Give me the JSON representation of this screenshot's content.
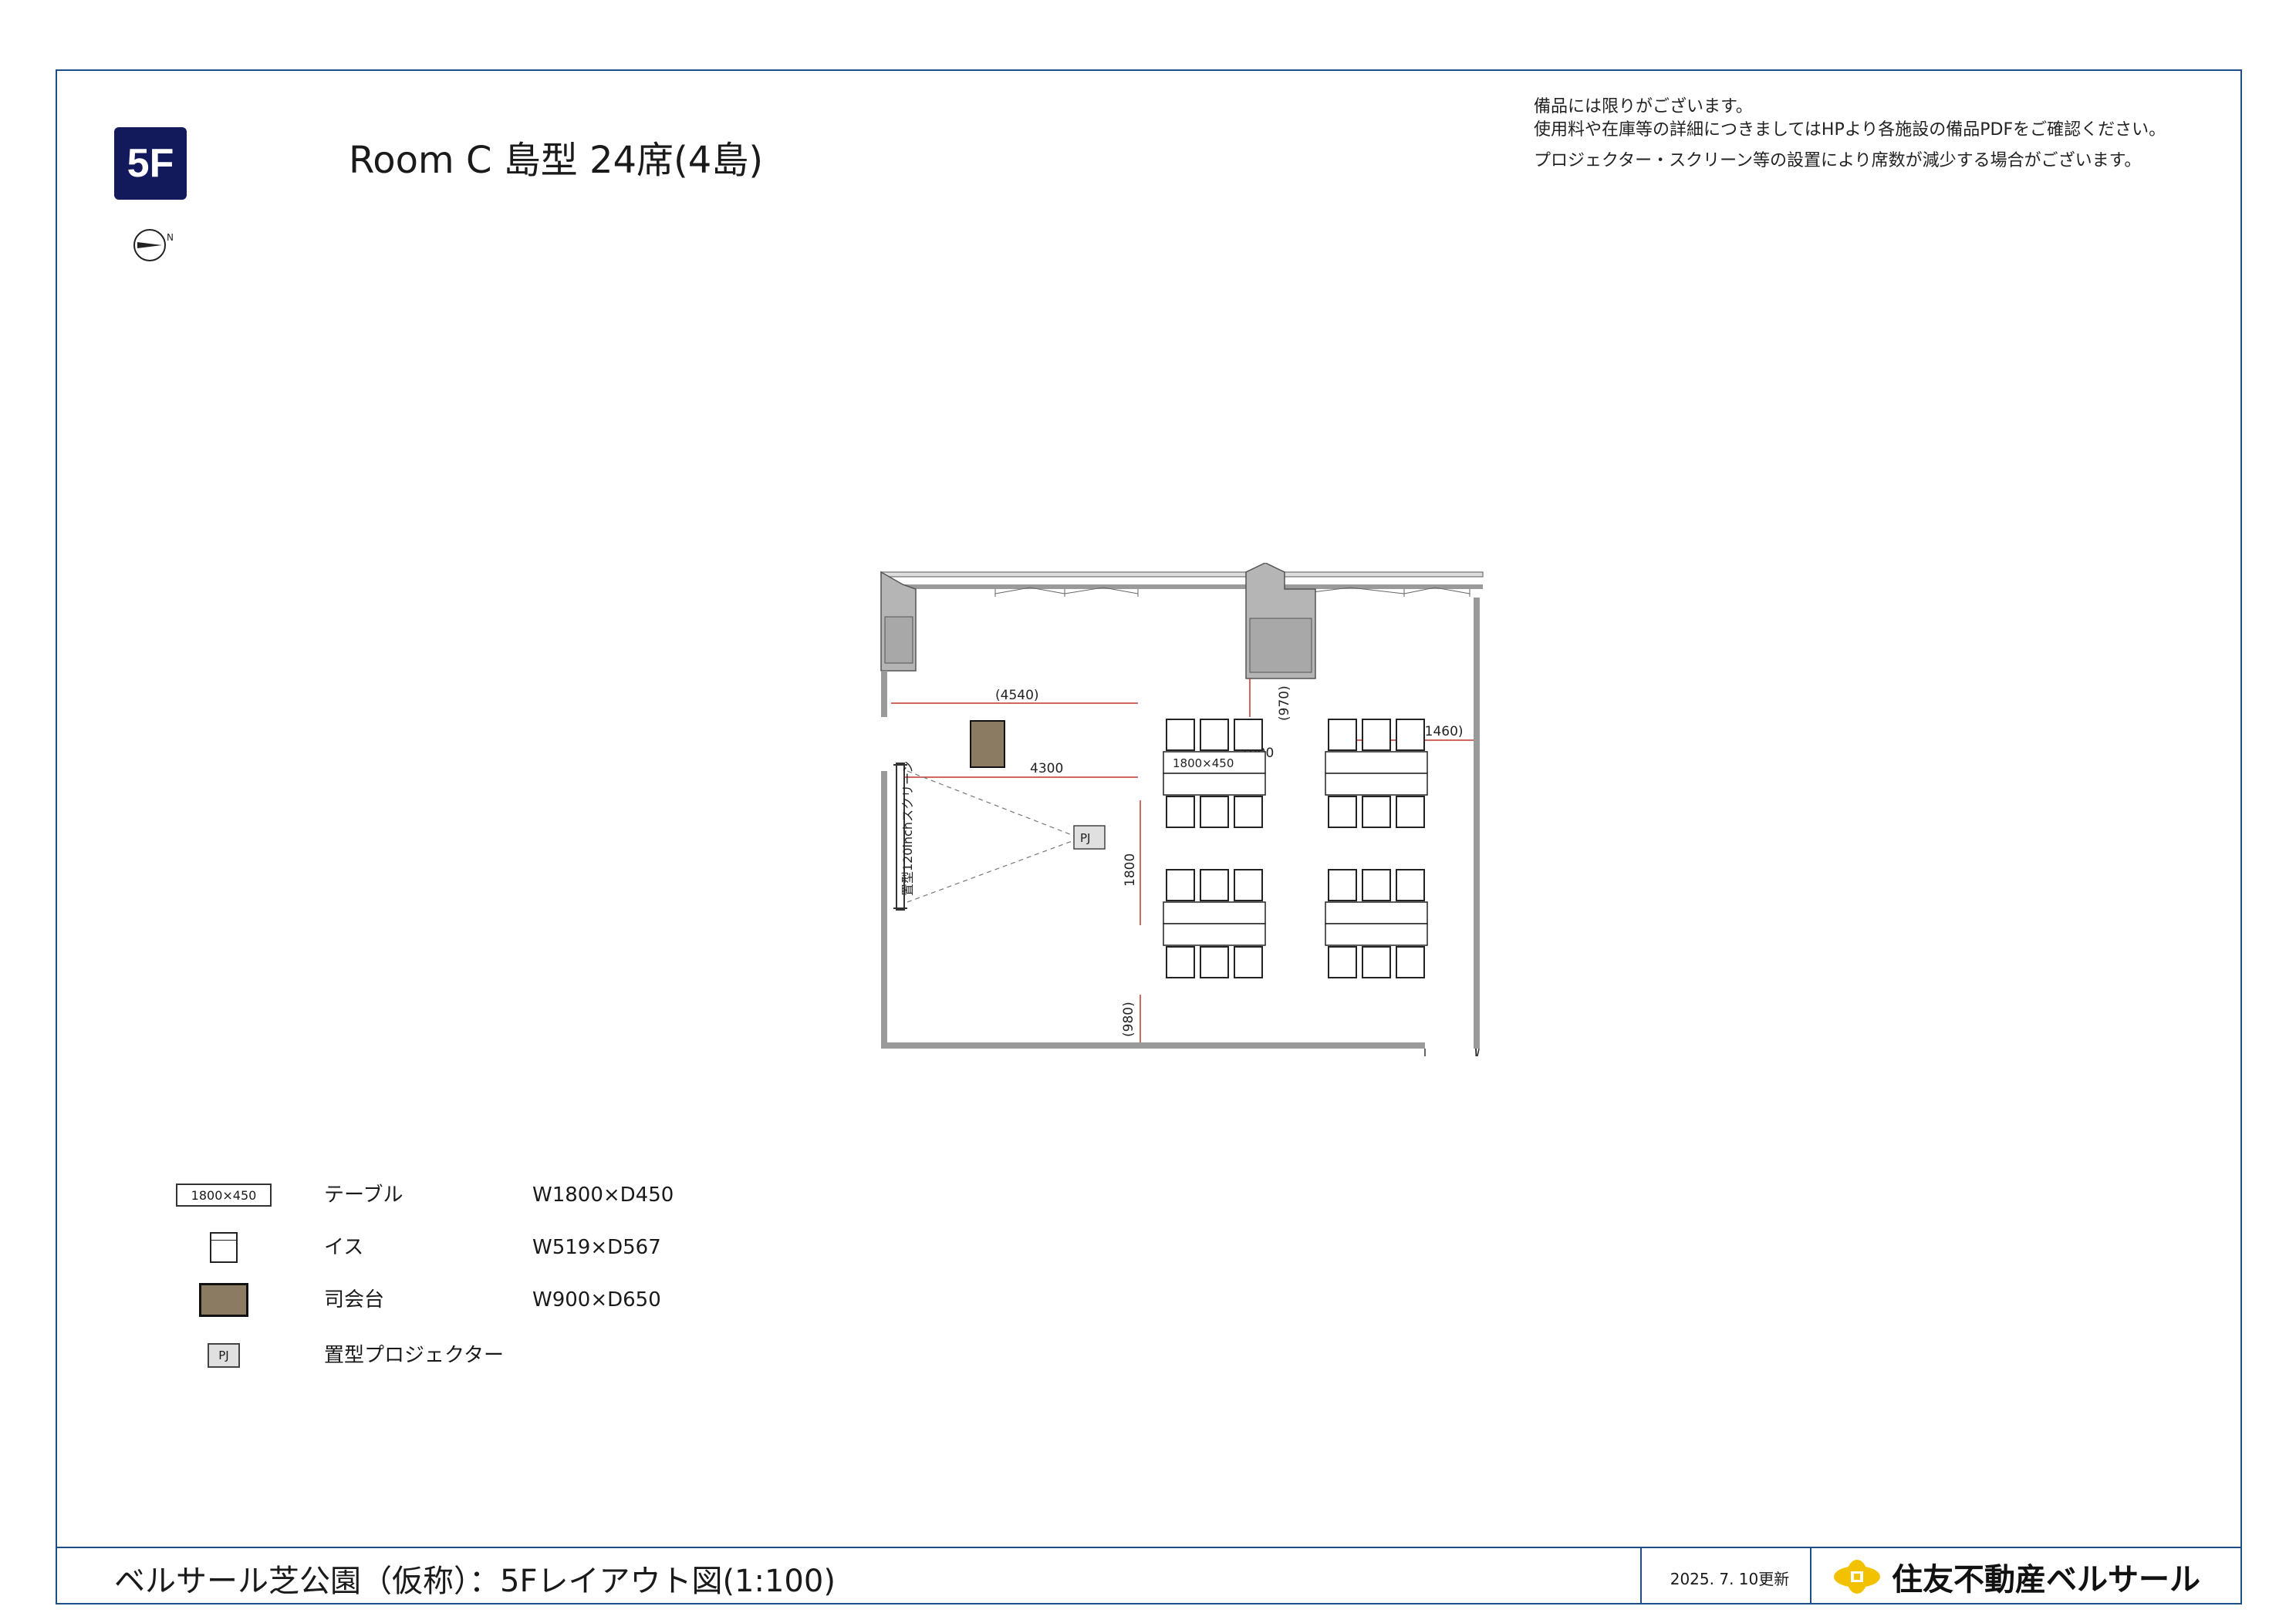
{
  "header": {
    "floor_badge": "5F",
    "room_title": "Room C 島型 24席(4島)",
    "notes": [
      "備品には限りがございます。",
      "使用料や在庫等の詳細につきましてはHPより各施設の備品PDFをご確認ください。",
      "プロジェクター・スクリーン等の設置により席数が減少する場合がございます。"
    ],
    "compass_label": "N"
  },
  "plan": {
    "dimensions": {
      "d4540": "(4540)",
      "d4300": "4300",
      "d1000": "1000",
      "d970": "(970)",
      "d1460": "(1460)",
      "d1800": "1800",
      "d980": "(980)"
    },
    "table_label": "1800×450",
    "screen_label": "置型120inchスクリーン",
    "projector_label": "PJ"
  },
  "legend": {
    "items": [
      {
        "symbol_text": "1800×450",
        "label": "テーブル",
        "dims": "W1800×D450"
      },
      {
        "symbol_text": "",
        "label": "イス",
        "dims": "W519×D567"
      },
      {
        "symbol_text": "",
        "label": "司会台",
        "dims": "W900×D650"
      },
      {
        "symbol_text": "PJ",
        "label": "置型プロジェクター",
        "dims": ""
      }
    ]
  },
  "footer": {
    "title": "ベルサール芝公園（仮称）：5Fレイアウト図(1:100)",
    "date": "2025. 7. 10更新",
    "brand": "住友不動産ベルサール"
  },
  "colors": {
    "frame": "#1d4f86",
    "badge": "#121a5c",
    "podium": "#8c7b63",
    "dimension_line": "#c0392b",
    "wall": "#9a9a9a",
    "logo": "#f2c200"
  }
}
